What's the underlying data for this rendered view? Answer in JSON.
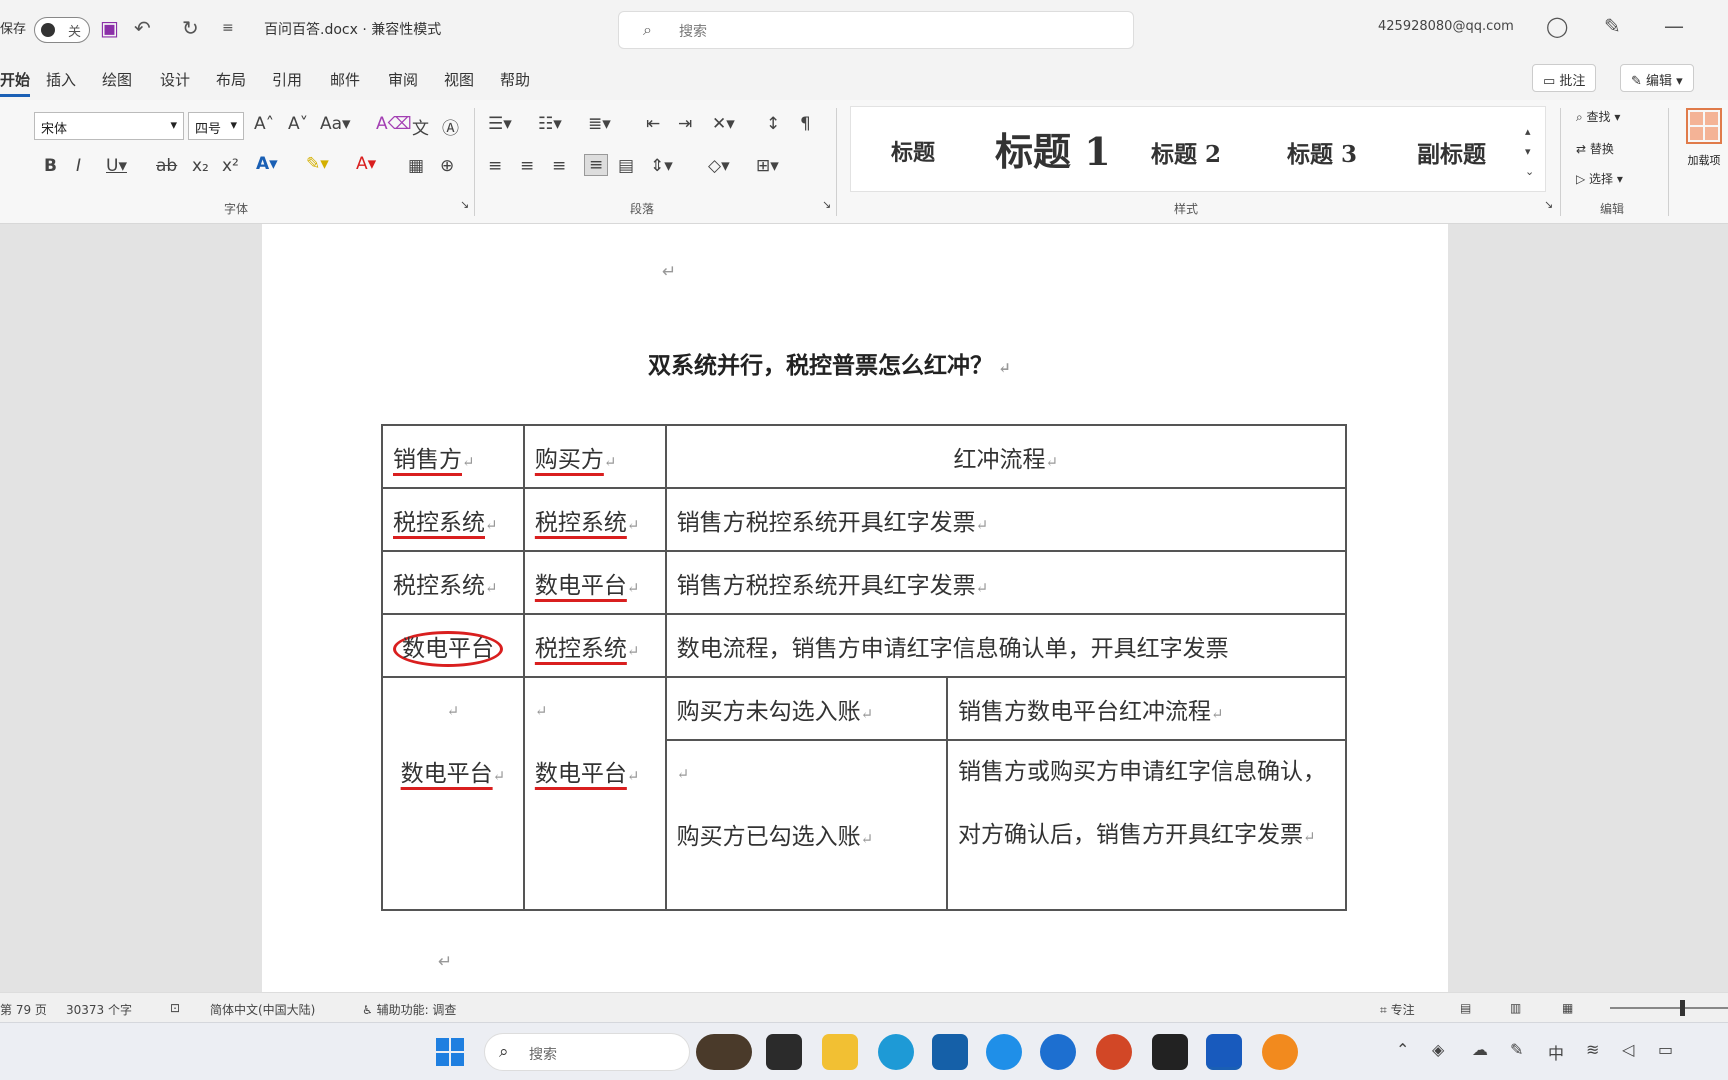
{
  "titlebar": {
    "autosave": "保存",
    "toggle": "关",
    "doc_name": "百问百答.docx · 兼容性模式",
    "search_placeholder": "搜索",
    "user": "425928080@qq.com"
  },
  "menu": {
    "tabs": [
      "开始",
      "插入",
      "绘图",
      "设计",
      "布局",
      "引用",
      "邮件",
      "审阅",
      "视图",
      "帮助"
    ],
    "comment_btn": "批注",
    "edit_btn": "编辑"
  },
  "ribbon": {
    "font_name": "宋体",
    "font_size": "四号",
    "group_font": "字体",
    "group_paragraph": "段落",
    "group_styles": "样式",
    "group_editing": "编辑",
    "group_addins": "加载项",
    "styles": [
      "标题",
      "标题 1",
      "标题 2",
      "标题 3",
      "副标题"
    ],
    "edit_find": "查找",
    "edit_replace": "替换",
    "edit_select": "选择",
    "addins_label": "加载项"
  },
  "document": {
    "title": "双系统并行，税控普票怎么红冲？",
    "table": {
      "header": [
        "销售方",
        "购买方",
        "红冲流程"
      ],
      "rows": [
        [
          "税控系统",
          "税控系统",
          "销售方税控系统开具红字发票"
        ],
        [
          "税控系统",
          "数电平台",
          "销售方税控系统开具红字发票"
        ],
        [
          "数电平台",
          "税控系统",
          "数电流程，销售方申请红字信息确认单，开具红字发票"
        ]
      ],
      "last": {
        "seller": "数电平台",
        "buyer": "数电平台",
        "case1_condition": "购买方未勾选入账",
        "case1_flow": "销售方数电平台红冲流程",
        "case2_condition": "购买方已勾选入账",
        "case2_flow": "销售方或购买方申请红字信息确认，对方确认后，销售方开具红字发票"
      }
    }
  },
  "statusbar": {
    "page": "第 79 页",
    "words": "30373 个字",
    "language": "简体中文(中国大陆)",
    "accessibility": "辅助功能: 调查",
    "focus": "专注"
  },
  "taskbar": {
    "search": "搜索"
  },
  "colors": {
    "ink": "#d91f1f",
    "accent": "#1a5fb4"
  }
}
